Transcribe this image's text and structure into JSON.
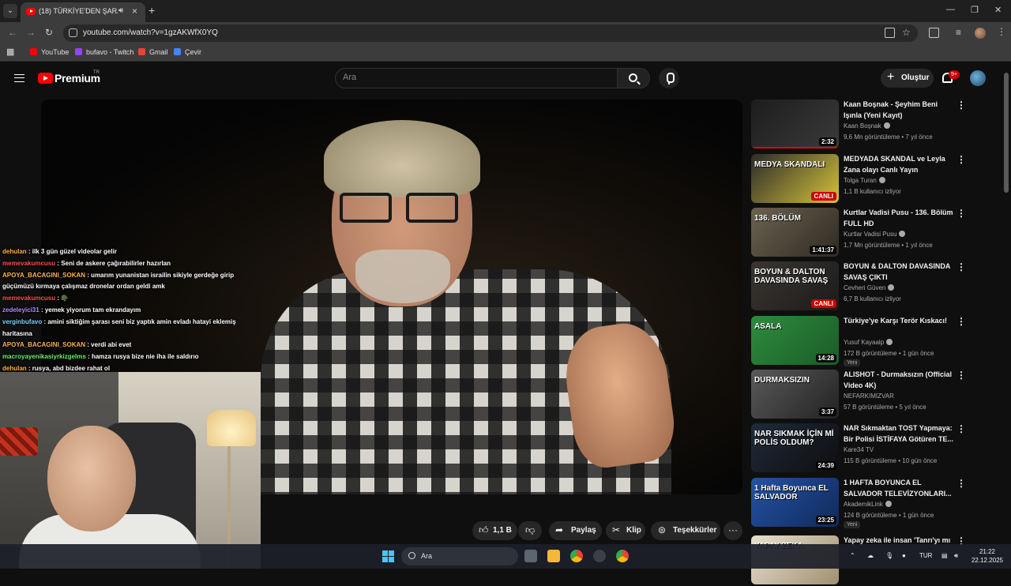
{
  "browser": {
    "tab_title": "(18) TÜRKİYE'DEN ŞARA'YA",
    "url": "youtube.com/watch?v=1gzAKWfX0YQ",
    "bookmarks": [
      "YouTube",
      "bufavo - Twitch",
      "Gmail",
      "Çevir"
    ]
  },
  "youtube": {
    "brand": "Premium",
    "region": "TR",
    "search_placeholder": "Ara",
    "create_label": "Oluştur",
    "notification_count": "9+"
  },
  "chat": [
    {
      "user": "dehulan",
      "user_color": "#ffb347",
      "text": ": ilk 3 gün güzel videolar gelir"
    },
    {
      "user": "memevakumcusu",
      "user_color": "#ff4d4d",
      "text": ": Seni de askere çağırabilirler hazırlan"
    },
    {
      "user": "APOYA_BACAGINI_SOKAN",
      "user_color": "#ffb347",
      "text": ": umarım yunanistan israilin sikiyle gerdeğe girip güçümüzü kırmaya çalışmaz dronelar ordan geldi amk"
    },
    {
      "user": "memevakumcusu",
      "user_color": "#ff4d4d",
      "text": ": 🪖"
    },
    {
      "user": "zedeleyici31",
      "user_color": "#b28cff",
      "text": ": yemek yiyorum tam ekrandayım"
    },
    {
      "user": "verginbufavo",
      "user_color": "#7ad3ff",
      "text": ": amini siktiğim şarası seni biz yaptık amin evladı hatayi eklemiş haritasına"
    },
    {
      "user": "APOYA_BACAGINI_SOKAN",
      "user_color": "#ffb347",
      "text": ": verdi abi evet"
    },
    {
      "user": "macroyayenikasiyrkizgelms",
      "user_color": "#6cf06c",
      "text": ": hamza rusya bize nie iha ile saldırıo"
    },
    {
      "user": "dehulan",
      "user_color": "#ffb347",
      "text": ": rusya, abd bizdee rahat ol"
    }
  ],
  "actions": {
    "likes": "1,1 B",
    "share": "Paylaş",
    "clip": "Klip",
    "thanks": "Teşekkürler"
  },
  "recommendations": [
    {
      "title": "Kaan Boşnak - Şeyhim Beni Işınla (Yeni Kayıt)",
      "channel": "Kaan Boşnak",
      "verified": true,
      "meta": "9,6 Mn görüntüleme • 7 yıl önce",
      "duration": "2:32",
      "thumb_text": "",
      "colors": [
        "#1d1d1d",
        "#3a3a3a"
      ],
      "watched": true
    },
    {
      "title": "MEDYADA SKANDAL ve Leyla Zana olayı Canlı Yayın",
      "channel": "Tolga Turan",
      "verified": true,
      "meta": "1,1 B kullanıcı izliyor",
      "duration": "CANLI",
      "thumb_text": "MEDYA SKANDALI",
      "colors": [
        "#2a2a2a",
        "#d4c23a"
      ],
      "live": true
    },
    {
      "title": "Kurtlar Vadisi Pusu - 136. Bölüm FULL HD",
      "channel": "Kurtlar Vadisi Pusu",
      "verified": true,
      "meta": "1,7 Mn görüntüleme • 1 yıl önce",
      "duration": "1:41:37",
      "thumb_text": "136. BÖLÜM",
      "colors": [
        "#6b6250",
        "#2f2a22"
      ]
    },
    {
      "title": "BOYUN & DALTON DAVASINDA SAVAŞ ÇIKTI",
      "channel": "Cevheri Güven",
      "verified": true,
      "meta": "6,7 B kullanıcı izliyor",
      "duration": "CANLI",
      "thumb_text": "BOYUN & DALTON DAVASINDA SAVAŞ",
      "colors": [
        "#3b3530",
        "#1b1b1b"
      ],
      "live": true
    },
    {
      "title": "Türkiye'ye Karşı Terör Kıskacı!",
      "channel": "Yusuf Kayaalp",
      "verified": true,
      "meta": "172 B görüntüleme • 1 gün önce",
      "duration": "14:28",
      "thumb_text": "ASALA",
      "colors": [
        "#2e8b3c",
        "#1a5c28"
      ],
      "new": "Yeni"
    },
    {
      "title": "ALISHOT - Durmaksızın (Official Video 4K)",
      "channel": "NEFARKIMIZVAR",
      "verified": false,
      "meta": "57 B görüntüleme • 5 yıl önce",
      "duration": "3:37",
      "thumb_text": "DURMAKSIZIN",
      "colors": [
        "#5a5a5a",
        "#222"
      ]
    },
    {
      "title": "NAR Sıkmaktan TOST Yapmaya: Bir Polisi İSTİFAYA Götüren TE...",
      "channel": "Kare34 TV",
      "verified": false,
      "meta": "115 B görüntüleme • 10 gün önce",
      "duration": "24:39",
      "thumb_text": "NAR SIKMAK İÇİN Mİ POLİS OLDUM?",
      "colors": [
        "#1f2a3a",
        "#0e0e0e"
      ]
    },
    {
      "title": "1 HAFTA BOYUNCA EL SALVADOR TELEVİZYONLARI...",
      "channel": "AkademikLink",
      "verified": true,
      "meta": "124 B görüntüleme • 1 gün önce",
      "duration": "23:25",
      "thumb_text": "1 Hafta Boyunca EL SALVADOR",
      "colors": [
        "#2452a3",
        "#102a5c"
      ],
      "new": "Yeni"
    },
    {
      "title": "Yapay zeka ile insan 'Tanrı'yı mı",
      "channel": "",
      "verified": false,
      "meta": "",
      "duration": "",
      "thumb_text": "YAPAY ZEKA",
      "colors": [
        "#e8e0d0",
        "#a09070"
      ]
    }
  ],
  "taskbar": {
    "search": "Ara",
    "lang": "TUR",
    "time": "21:22",
    "date": "22.12.2025"
  }
}
